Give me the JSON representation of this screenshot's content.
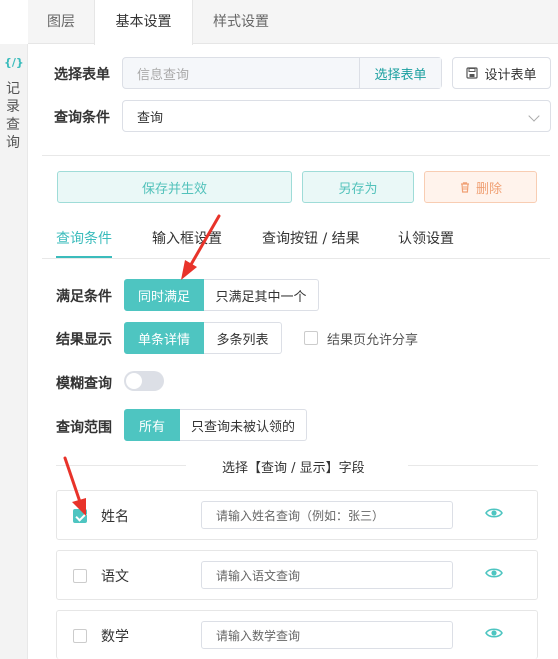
{
  "tabs": [
    {
      "label": "图层"
    },
    {
      "label": "基本设置"
    },
    {
      "label": "样式设置"
    }
  ],
  "left_rail": {
    "icon_text": "{/}",
    "label": "记录查询"
  },
  "form_select": {
    "label": "选择表单",
    "placeholder": "信息查询",
    "append_label": "选择表单",
    "design_label": "设计表单"
  },
  "query_condition": {
    "label": "查询条件",
    "value": "查询"
  },
  "actions": {
    "save": "保存并生效",
    "save_as": "另存为",
    "delete": "删除"
  },
  "subtabs": [
    {
      "label": "查询条件"
    },
    {
      "label": "输入框设置"
    },
    {
      "label": "查询按钮 / 结果"
    },
    {
      "label": "认领设置"
    }
  ],
  "satisfy": {
    "label": "满足条件",
    "options": [
      "同时满足",
      "只满足其中一个"
    ],
    "selected": "同时满足"
  },
  "result_display": {
    "label": "结果显示",
    "options": [
      "单条详情",
      "多条列表"
    ],
    "selected": "单条详情",
    "share_label": "结果页允许分享",
    "share_checked": false
  },
  "fuzzy": {
    "label": "模糊查询",
    "enabled": false
  },
  "scope": {
    "label": "查询范围",
    "options": [
      "所有",
      "只查询未被认领的"
    ],
    "selected": "所有"
  },
  "field_section_title": "选择【查询 / 显示】字段",
  "fields": [
    {
      "name": "姓名",
      "placeholder": "请输入姓名查询（例如：张三）",
      "checked": true
    },
    {
      "name": "语文",
      "placeholder": "请输入语文查询",
      "checked": false
    },
    {
      "name": "数学",
      "placeholder": "请输入数学查询",
      "checked": false
    }
  ],
  "colors": {
    "accent": "#4ec5c1",
    "arrow": "#e8332a",
    "danger": "#f0a074"
  }
}
